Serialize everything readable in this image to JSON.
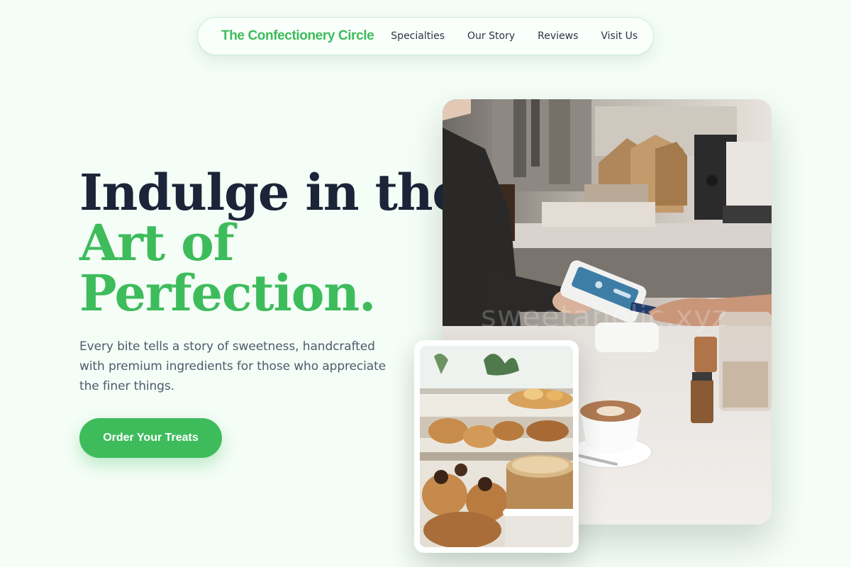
{
  "nav": {
    "brand": "The Confectionery Circle",
    "links": [
      "Specialties",
      "Our Story",
      "Reviews",
      "Visit Us"
    ]
  },
  "hero": {
    "title_line1": "Indulge in the",
    "title_line2": "Art of",
    "title_line3": "Perfection.",
    "subtitle": "Every bite tells a story of sweetness, handcrafted with premium ingredients for those who appreciate the finer things.",
    "cta_label": "Order Your Treats"
  },
  "images": {
    "main_watermark": "sweetaholic.xyz"
  },
  "colors": {
    "accent": "#3ebc5c",
    "heading": "#1b2438",
    "body_text": "#4f5a6c",
    "background": "#f4fdf6"
  }
}
